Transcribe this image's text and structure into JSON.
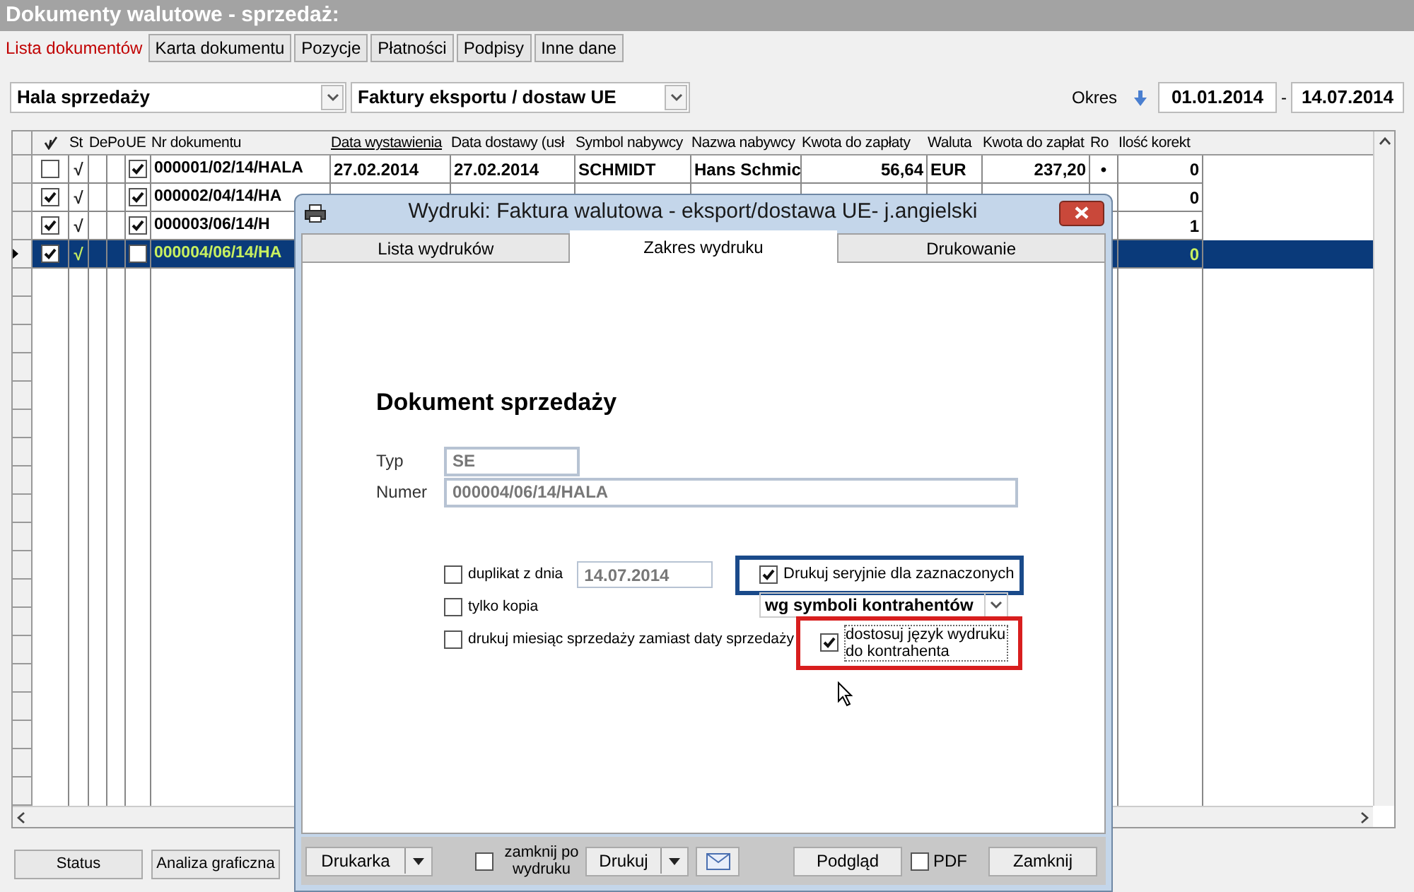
{
  "window": {
    "title": "Dokumenty walutowe - sprzedaż:"
  },
  "tabs": [
    {
      "label": "Lista dokumentów",
      "selected": true
    },
    {
      "label": "Karta dokumentu",
      "selected": false
    },
    {
      "label": "Pozycje",
      "selected": false
    },
    {
      "label": "Płatności",
      "selected": false
    },
    {
      "label": "Podpisy",
      "selected": false
    },
    {
      "label": "Inne dane",
      "selected": false
    }
  ],
  "filters": {
    "unit": "Hala sprzedaży",
    "doc_type": "Faktury eksportu / dostaw UE",
    "period_label": "Okres",
    "date_from": "01.01.2014",
    "date_separator": "-",
    "date_to": "14.07.2014"
  },
  "table": {
    "columns": [
      {
        "label": "St",
        "sorted": false
      },
      {
        "label": "De",
        "sorted": false
      },
      {
        "label": "Po",
        "sorted": false
      },
      {
        "label": "UE",
        "sorted": false
      },
      {
        "label": "Nr dokumentu",
        "sorted": false
      },
      {
        "label": "Data wystawienia",
        "sorted": true
      },
      {
        "label": "Data dostawy (usł",
        "sorted": false
      },
      {
        "label": "Symbol nabywcy",
        "sorted": false
      },
      {
        "label": "Nazwa nabywcy",
        "sorted": false
      },
      {
        "label": "Kwota do zapłaty",
        "sorted": false
      },
      {
        "label": "Waluta",
        "sorted": false
      },
      {
        "label": "Kwota do zapłat",
        "sorted": false
      },
      {
        "label": "Ro",
        "sorted": false
      },
      {
        "label": "Ilość korekt",
        "sorted": false
      }
    ],
    "rows": [
      {
        "selected": false,
        "checked": false,
        "status": "√",
        "ue_checked": true,
        "number": "000001/02/14/HALA",
        "issue_date": "27.02.2014",
        "delivery_date": "27.02.2014",
        "buyer_symbol": "SCHMIDT",
        "buyer_name": "Hans Schmic",
        "amount": "56,64",
        "currency": "EUR",
        "amount_2": "237,20",
        "settled": "•",
        "corrections": "0"
      },
      {
        "selected": false,
        "checked": true,
        "status": "√",
        "ue_checked": true,
        "number": "000002/04/14/HA",
        "corrections": "0"
      },
      {
        "selected": false,
        "checked": true,
        "status": "√",
        "ue_checked": true,
        "number": "000003/06/14/H",
        "corrections": "1"
      },
      {
        "selected": true,
        "checked": true,
        "status": "√",
        "ue_checked": false,
        "number": "000004/06/14/HA",
        "corrections": "0"
      }
    ]
  },
  "bottom_buttons": [
    "Status",
    "Analiza graficzna"
  ],
  "dialog": {
    "title": "Wydruki: Faktura walutowa - eksport/dostawa UE- j.angielski",
    "tabs": [
      {
        "label": "Lista wydruków",
        "selected": false
      },
      {
        "label": "Zakres wydruku",
        "selected": true
      },
      {
        "label": "Drukowanie",
        "selected": false
      }
    ],
    "section_title": "Dokument sprzedaży",
    "type": {
      "label": "Typ",
      "value": "SE"
    },
    "number": {
      "label": "Numer",
      "value": "000004/06/14/HALA"
    },
    "duplicate": {
      "label": "duplikat z dnia",
      "checked": false,
      "date": "14.07.2014"
    },
    "only_copy": {
      "label": "tylko kopia",
      "checked": false
    },
    "sale_month": {
      "label": "drukuj miesiąc sprzedaży zamiast daty sprzedaży",
      "checked": false
    },
    "serial": {
      "label": "Drukuj seryjnie dla zaznaczonych",
      "checked": true,
      "color": "#1a4a8a"
    },
    "serial_mode": "wg symboli kontrahentów",
    "language": {
      "label": "dostosuj język wydruku do kontrahenta",
      "checked": true,
      "color": "#d81e1e"
    },
    "footer": {
      "printer": "Drukarka",
      "close_after": {
        "label": "zamknij po wydruku",
        "checked": false
      },
      "print": "Drukuj",
      "preview": "Podgląd",
      "pdf": {
        "label": "PDF",
        "checked": false
      },
      "close": "Zamknij"
    }
  }
}
